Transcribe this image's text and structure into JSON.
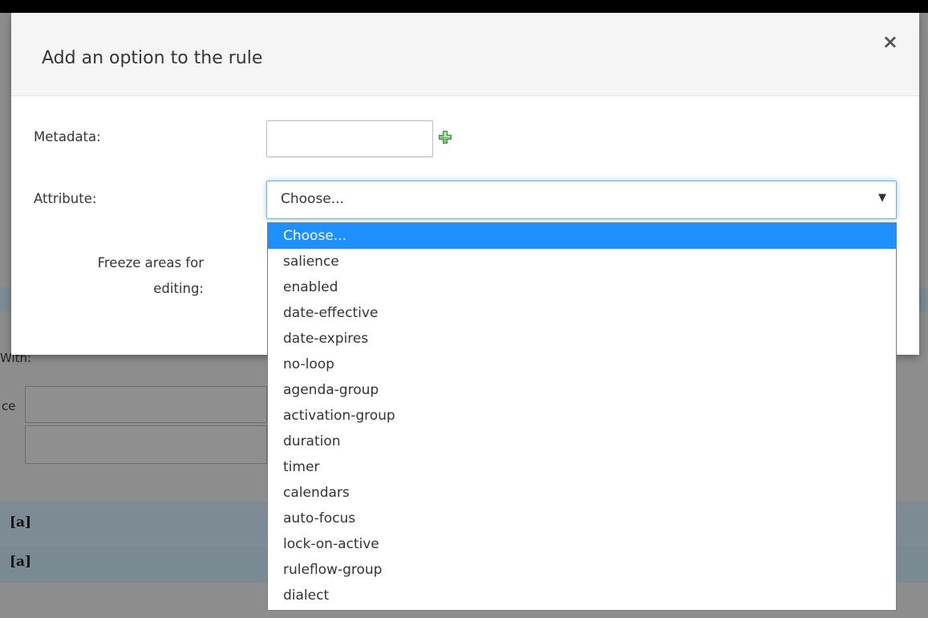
{
  "background": {
    "with_label": "With:",
    "row_prefix": "ce",
    "bracket_labels": [
      "[a]",
      "[a]"
    ]
  },
  "modal": {
    "title": "Add an option to the rule",
    "close_glyph": "×",
    "metadata_label": "Metadata:",
    "metadata_value": "",
    "attribute_label": "Attribute:",
    "freeze_label_line1": "Freeze areas for",
    "freeze_label_line2": "editing:",
    "attribute_selected": "Choose...",
    "attribute_caret": "▼"
  },
  "dropdown": {
    "options": [
      "Choose...",
      "salience",
      "enabled",
      "date-effective",
      "date-expires",
      "no-loop",
      "agenda-group",
      "activation-group",
      "duration",
      "timer",
      "calendars",
      "auto-focus",
      "lock-on-active",
      "ruleflow-group",
      "dialect"
    ],
    "highlighted_index": 0
  },
  "colors": {
    "highlight": "#1e90ff",
    "add_icon": "#5cb85c",
    "focus_ring": "#66afe9"
  }
}
